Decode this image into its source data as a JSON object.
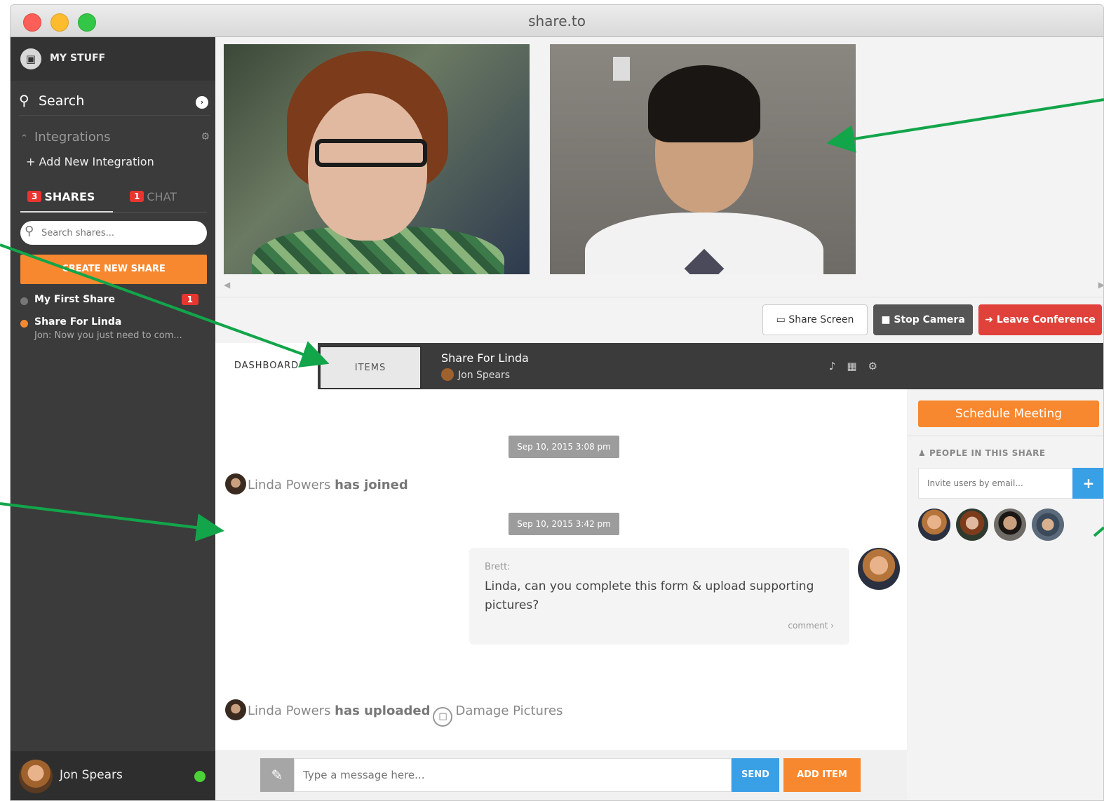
{
  "window": {
    "title": "share.to"
  },
  "sidebar": {
    "my_stuff": "MY STUFF",
    "search_label": "Search",
    "integrations_label": "Integrations",
    "add_integration": "Add New Integration",
    "tabs": [
      {
        "label": "SHARES",
        "badge": "3"
      },
      {
        "label": "CHAT",
        "badge": "1"
      }
    ],
    "search_shares_placeholder": "Search shares...",
    "create_button": "CREATE NEW SHARE",
    "shares": [
      {
        "name": "My First Share",
        "badge": "1",
        "subtitle": "",
        "dot_color": "#777777"
      },
      {
        "name": "Share For Linda",
        "badge": "",
        "subtitle": "Jon: Now you just need to com...",
        "dot_color": "#f7882f"
      }
    ],
    "user": {
      "name": "Jon Spears",
      "status_color": "#4cd137"
    }
  },
  "conference": {
    "share_screen": "Share Screen",
    "stop_camera": "Stop Camera",
    "leave": "Leave Conference"
  },
  "share_header": {
    "tab_dashboard": "DASHBOARD",
    "tab_items": "ITEMS",
    "title": "Share For Linda",
    "owner": "Jon Spears"
  },
  "feed": {
    "events": [
      {
        "type": "timestamp",
        "text": "Sep 10, 2015 3:08 pm"
      },
      {
        "type": "activity",
        "user": "Linda Powers",
        "action": "has joined"
      },
      {
        "type": "timestamp",
        "text": "Sep 10, 2015 3:42 pm"
      },
      {
        "type": "message",
        "author": "Brett:",
        "text": "Linda, can you complete this form & upload supporting pictures?",
        "comment_link": "comment ›"
      },
      {
        "type": "activity",
        "user": "Linda Powers",
        "action": "has uploaded",
        "item": "Damage Pictures"
      }
    ]
  },
  "composer": {
    "placeholder": "Type a message here...",
    "send": "SEND",
    "add_item": "ADD ITEM"
  },
  "right_panel": {
    "schedule_button": "Schedule Meeting",
    "people_heading": "PEOPLE IN THIS SHARE",
    "invite_placeholder": "Invite users by email...",
    "invite_add": "+",
    "people_count": 4
  },
  "colors": {
    "accent_orange": "#f7882f",
    "accent_blue": "#3aa0e6",
    "danger_red": "#e0413b",
    "annotation_green": "#12a54a",
    "sidebar_bg": "#3b3b3b"
  }
}
